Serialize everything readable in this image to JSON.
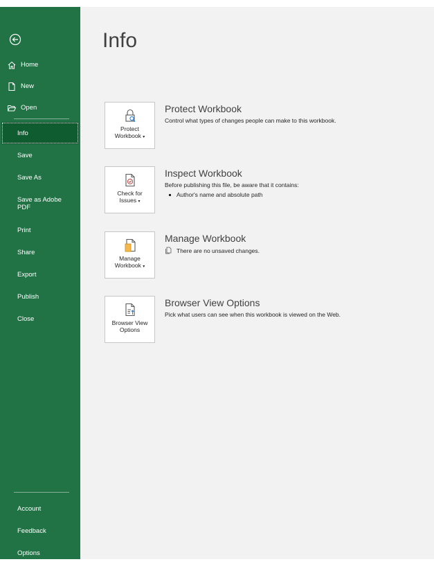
{
  "sidebar": {
    "top_items": [
      {
        "label": "Home",
        "icon": "home-icon"
      },
      {
        "label": "New",
        "icon": "new-document-icon"
      },
      {
        "label": "Open",
        "icon": "open-folder-icon"
      }
    ],
    "main_items": [
      {
        "label": "Info",
        "selected": true
      },
      {
        "label": "Save"
      },
      {
        "label": "Save As"
      },
      {
        "label": "Save as Adobe PDF"
      },
      {
        "label": "Print"
      },
      {
        "label": "Share"
      },
      {
        "label": "Export"
      },
      {
        "label": "Publish"
      },
      {
        "label": "Close"
      }
    ],
    "bottom_items": [
      {
        "label": "Account"
      },
      {
        "label": "Feedback"
      },
      {
        "label": "Options"
      }
    ]
  },
  "main": {
    "title": "Info",
    "protect": {
      "tile_line1": "Protect",
      "tile_line2": "Workbook",
      "title": "Protect Workbook",
      "description": "Control what types of changes people can make to this workbook."
    },
    "inspect": {
      "tile_line1": "Check for",
      "tile_line2": "Issues",
      "title": "Inspect Workbook",
      "description": "Before publishing this file, be aware that it contains:",
      "bullets": [
        "Author's name and absolute path"
      ]
    },
    "manage": {
      "tile_line1": "Manage",
      "tile_line2": "Workbook",
      "title": "Manage Workbook",
      "status": "There are no unsaved changes."
    },
    "browser": {
      "tile_line1": "Browser View",
      "tile_line2": "Options",
      "title": "Browser View Options",
      "description": "Pick what users can see when this workbook is viewed on the Web."
    }
  },
  "colors": {
    "sidebar_bg": "#217346",
    "sidebar_selected": "#0e5c2f",
    "main_bg": "#f2f2f2"
  }
}
